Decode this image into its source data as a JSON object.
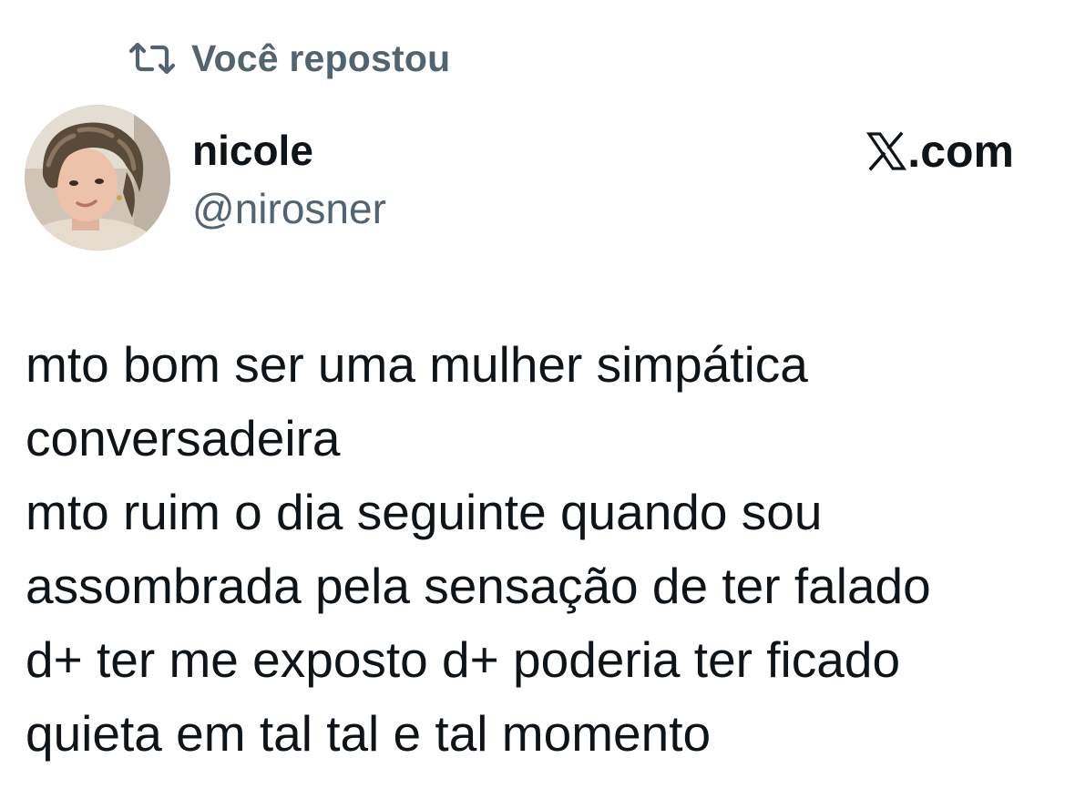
{
  "repost": {
    "label": "Você repostou",
    "icon": "repost-icon"
  },
  "author": {
    "display_name": "nicole",
    "handle": "@nirosner",
    "avatar_icon": "profile-photo"
  },
  "brand": {
    "logo_icon": "x-logo-icon",
    "domain_suffix": ".com"
  },
  "tweet": {
    "lines": [
      "mto bom ser uma mulher simpática",
      "conversadeira",
      "mto ruim o dia seguinte quando sou",
      "assombrada pela sensação de ter falado",
      "d+ ter me exposto d+ poderia ter ficado",
      "quieta em tal tal e tal momento"
    ]
  },
  "colors": {
    "text_primary": "#0f1419",
    "text_secondary": "#536471",
    "background": "#ffffff"
  }
}
